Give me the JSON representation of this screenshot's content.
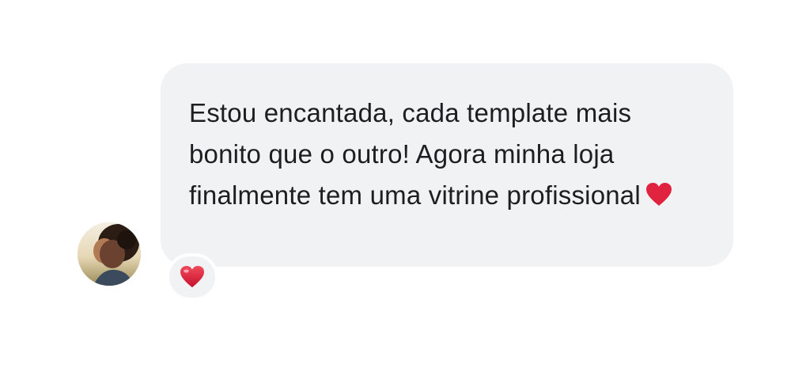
{
  "message": {
    "text": "Estou encantada, cada template mais bonito que o outro! Agora minha loja finalmente tem uma vitrine profissional",
    "trailing_icon": "red-heart-icon"
  },
  "sender": {
    "avatar_icon": "avatar-photo"
  },
  "reaction": {
    "icon": "red-heart-reaction-icon",
    "color": "#e02440"
  },
  "colors": {
    "bubble": "#f1f2f4",
    "text": "#1c1e21",
    "heart": "#e02440"
  }
}
